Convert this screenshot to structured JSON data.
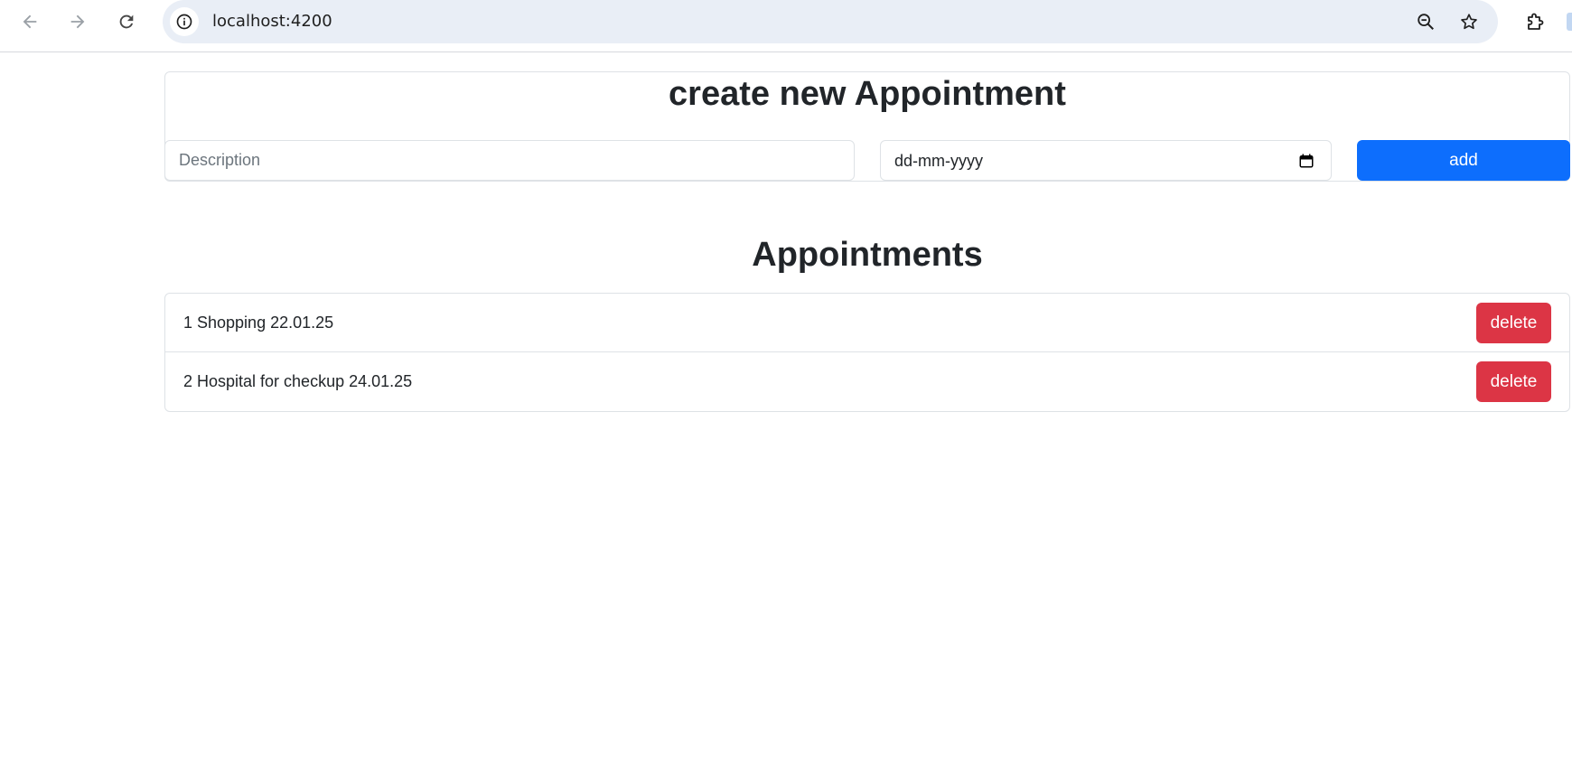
{
  "browser": {
    "url": "localhost:4200"
  },
  "icons": {
    "back": "arrow-left-icon",
    "forward": "arrow-right-icon",
    "reload": "reload-icon",
    "site_info": "info-icon",
    "zoom": "zoom-out-icon",
    "bookmark": "star-icon",
    "extensions": "puzzle-icon",
    "calendar": "calendar-icon"
  },
  "create": {
    "title": "create new Appointment",
    "description_placeholder": "Description",
    "date_value": "dd-mm-yyyy",
    "add_label": "add"
  },
  "appointments": {
    "title": "Appointments",
    "items": [
      {
        "text": "1 Shopping 22.01.25",
        "delete_label": "delete"
      },
      {
        "text": "2 Hospital for checkup 24.01.25",
        "delete_label": "delete"
      }
    ]
  },
  "colors": {
    "primary": "#0d6efd",
    "danger": "#dc3545",
    "text": "#212529",
    "omnibox": "#e9eef6"
  }
}
